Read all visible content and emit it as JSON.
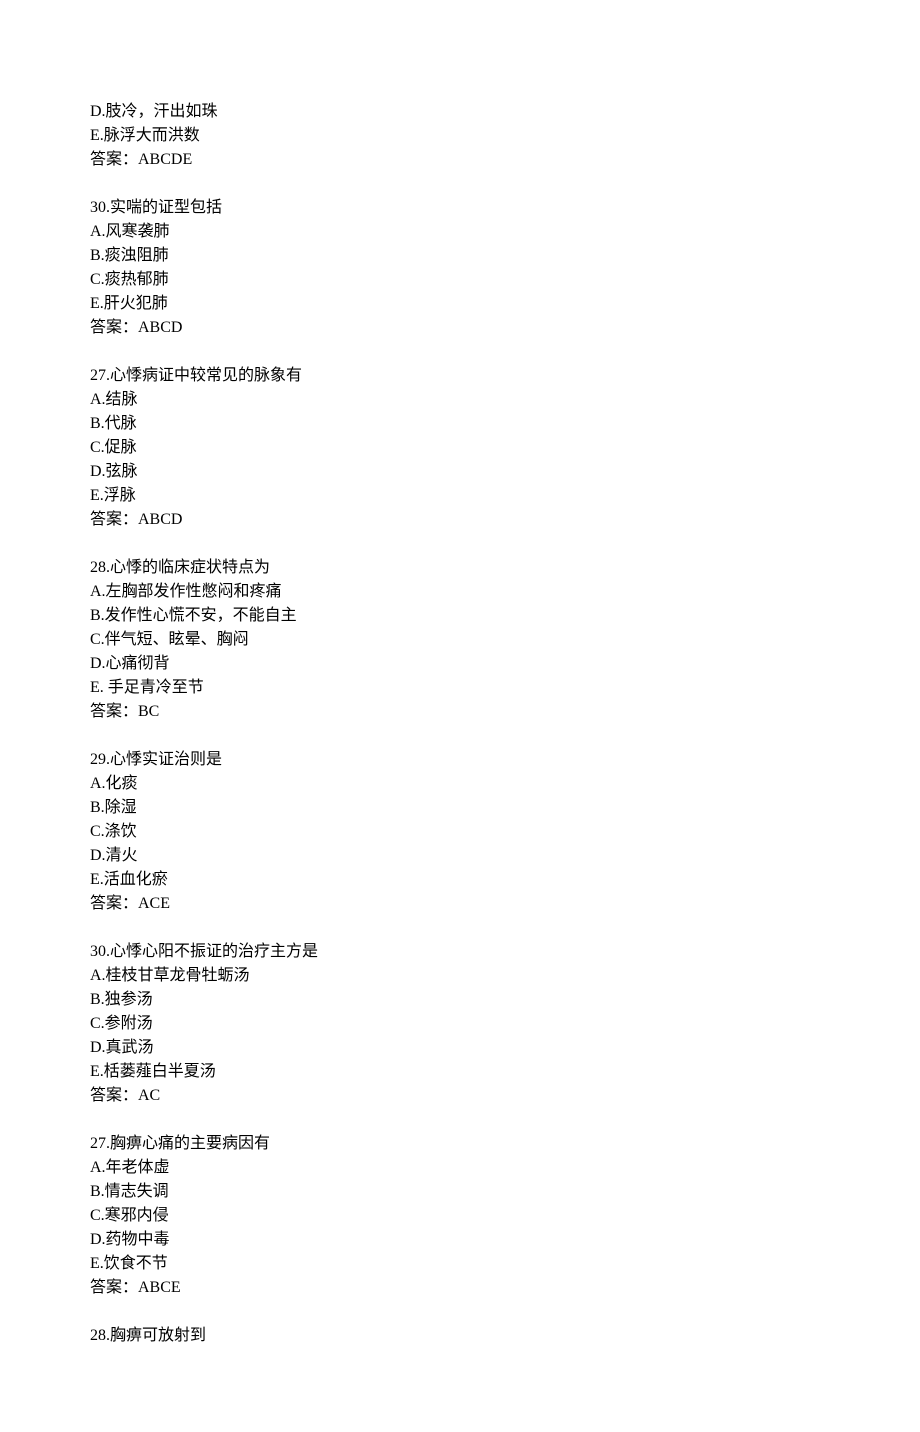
{
  "leading": {
    "optD": "D.肢冷，汗出如珠",
    "optE": "E.脉浮大而洪数",
    "answer": "答案：ABCDE"
  },
  "questions": [
    {
      "num": "30",
      "stem": "实喘的证型包括",
      "options": [
        "A.风寒袭肺",
        "B.痰浊阻肺",
        "C.痰热郁肺",
        "E.肝火犯肺"
      ],
      "answer": "答案：ABCD"
    },
    {
      "num": "27",
      "stem": "心悸病证中较常见的脉象有",
      "options": [
        "A.结脉",
        "B.代脉",
        "C.促脉",
        "D.弦脉",
        "E.浮脉"
      ],
      "answer": "答案：ABCD"
    },
    {
      "num": "28",
      "stem": "心悸的临床症状特点为",
      "options": [
        "A.左胸部发作性憋闷和疼痛",
        "B.发作性心慌不安，不能自主",
        "C.伴气短、眩晕、胸闷",
        "D.心痛彻背",
        "E. 手足青冷至节"
      ],
      "answer": "答案：BC"
    },
    {
      "num": "29",
      "stem": "心悸实证治则是",
      "options": [
        "A.化痰",
        "B.除湿",
        "C.涤饮",
        "D.清火",
        "E.活血化瘀"
      ],
      "answer": "答案：ACE"
    },
    {
      "num": "30",
      "stem": "心悸心阳不振证的治疗主方是",
      "options": [
        "A.桂枝甘草龙骨牡蛎汤",
        "B.独参汤",
        "C.参附汤",
        "D.真武汤",
        "E.栝蒌薤白半夏汤"
      ],
      "answer": "答案：AC"
    },
    {
      "num": "27",
      "stem": "胸痹心痛的主要病因有",
      "options": [
        "A.年老体虚",
        "B.情志失调",
        "C.寒邪内侵",
        "D.药物中毒",
        "E.饮食不节"
      ],
      "answer": "答案：ABCE"
    },
    {
      "num": "28",
      "stem": "胸痹可放射到",
      "options": [],
      "answer": ""
    }
  ]
}
